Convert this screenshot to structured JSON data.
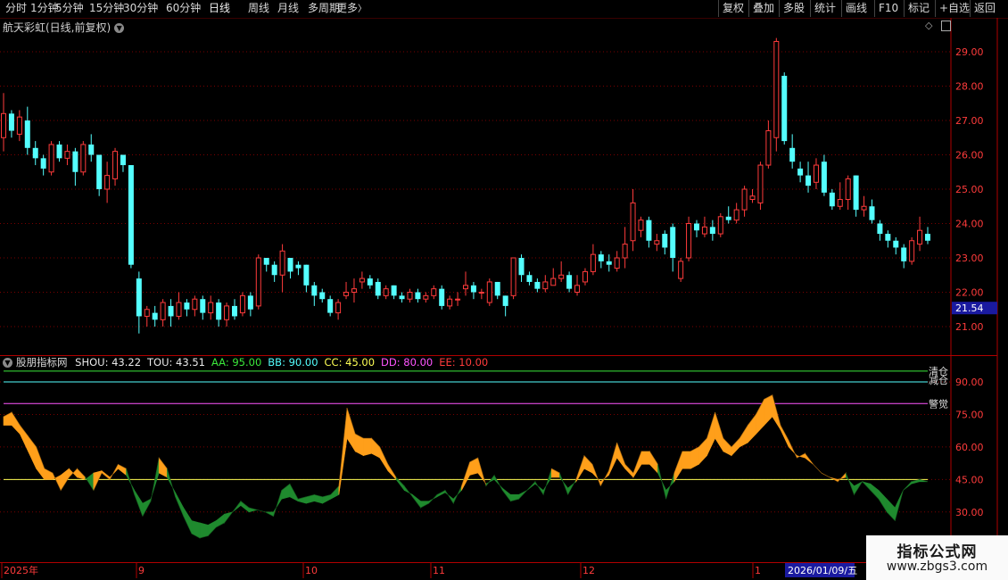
{
  "toolbar": {
    "left_items": [
      "分时",
      "1分钟",
      "5分钟",
      "15分钟",
      "30分钟",
      "60分钟",
      "日线",
      "周线",
      "月线",
      "多周期",
      "更多"
    ],
    "more_arrow": "〉",
    "active": "日线",
    "right_items": [
      "复权",
      "叠加",
      "多股",
      "统计",
      "画线",
      "F10",
      "标记",
      "+自选",
      "返回"
    ]
  },
  "main_chart": {
    "title": "航天彩虹(日线,前复权)",
    "price_axis": [
      "29.00",
      "28.00",
      "27.00",
      "26.00",
      "25.00",
      "24.00",
      "23.00",
      "22.00",
      "21.00"
    ],
    "current_price_tag": "21.54",
    "colors": {
      "up": "#ff3b3b",
      "down": "#54ffff",
      "grid": "#7a0000",
      "axis": "#ff3b3b",
      "price_tag_bg": "#1a1aa0"
    },
    "candles": [
      [
        26.5,
        27.2,
        26.1,
        27.8
      ],
      [
        27.2,
        26.7,
        26.5,
        27.3
      ],
      [
        26.6,
        27.1,
        26.4,
        27.3
      ],
      [
        27.0,
        26.2,
        26.0,
        27.4
      ],
      [
        26.2,
        25.9,
        25.7,
        26.4
      ],
      [
        25.9,
        25.6,
        25.4,
        26.0
      ],
      [
        25.5,
        26.3,
        25.4,
        26.4
      ],
      [
        26.3,
        25.9,
        25.8,
        26.4
      ],
      [
        25.9,
        26.1,
        25.7,
        26.3
      ],
      [
        26.1,
        25.5,
        25.1,
        26.2
      ],
      [
        25.5,
        26.3,
        25.4,
        26.4
      ],
      [
        26.3,
        26.0,
        25.8,
        26.6
      ],
      [
        26.0,
        25.0,
        24.8,
        26.0
      ],
      [
        25.0,
        25.4,
        24.6,
        25.8
      ],
      [
        25.3,
        26.1,
        25.1,
        26.2
      ],
      [
        26.0,
        25.7,
        25.5,
        26.0
      ],
      [
        25.7,
        22.8,
        22.7,
        25.7
      ],
      [
        22.4,
        21.3,
        20.8,
        22.6
      ],
      [
        21.3,
        21.5,
        21.0,
        21.6
      ],
      [
        21.4,
        21.2,
        21.0,
        21.6
      ],
      [
        21.2,
        21.7,
        21.0,
        21.8
      ],
      [
        21.6,
        21.3,
        21.0,
        21.8
      ],
      [
        21.3,
        21.7,
        21.2,
        22.0
      ],
      [
        21.7,
        21.5,
        21.3,
        21.8
      ],
      [
        21.5,
        21.8,
        21.3,
        21.9
      ],
      [
        21.8,
        21.4,
        21.2,
        21.9
      ],
      [
        21.4,
        21.7,
        21.2,
        21.9
      ],
      [
        21.7,
        21.2,
        21.0,
        21.8
      ],
      [
        21.2,
        21.6,
        21.0,
        21.7
      ],
      [
        21.6,
        21.3,
        21.2,
        21.8
      ],
      [
        21.4,
        21.9,
        21.3,
        22.0
      ],
      [
        21.9,
        21.5,
        21.3,
        22.0
      ],
      [
        21.6,
        23.0,
        21.5,
        23.1
      ],
      [
        23.0,
        22.8,
        22.6,
        23.0
      ],
      [
        22.8,
        22.5,
        22.3,
        22.9
      ],
      [
        22.5,
        23.2,
        22.0,
        23.4
      ],
      [
        23.0,
        22.6,
        22.4,
        23.0
      ],
      [
        22.8,
        22.7,
        22.5,
        22.9
      ],
      [
        22.8,
        22.2,
        22.0,
        22.8
      ],
      [
        22.2,
        21.9,
        21.6,
        22.3
      ],
      [
        22.0,
        21.8,
        21.7,
        22.1
      ],
      [
        21.8,
        21.4,
        21.3,
        21.9
      ],
      [
        21.4,
        21.7,
        21.2,
        21.8
      ],
      [
        21.9,
        22.0,
        21.8,
        22.3
      ],
      [
        22.0,
        22.1,
        21.7,
        22.4
      ],
      [
        22.3,
        22.4,
        22.1,
        22.6
      ],
      [
        22.4,
        22.2,
        22.1,
        22.5
      ],
      [
        22.3,
        21.9,
        21.8,
        22.4
      ],
      [
        21.9,
        22.1,
        21.8,
        22.2
      ],
      [
        22.2,
        21.9,
        21.8,
        22.2
      ],
      [
        21.9,
        21.8,
        21.7,
        22.0
      ],
      [
        21.8,
        22.0,
        21.7,
        22.1
      ],
      [
        22.0,
        21.8,
        21.7,
        22.1
      ],
      [
        21.8,
        21.9,
        21.7,
        22.0
      ],
      [
        21.9,
        22.1,
        21.8,
        22.2
      ],
      [
        22.1,
        21.6,
        21.5,
        22.2
      ],
      [
        21.6,
        21.8,
        21.5,
        21.9
      ],
      [
        21.8,
        21.8,
        21.6,
        22.0
      ],
      [
        22.1,
        22.2,
        21.9,
        22.6
      ],
      [
        22.2,
        22.0,
        21.8,
        22.3
      ],
      [
        22.0,
        22.0,
        21.8,
        22.1
      ],
      [
        21.7,
        22.3,
        21.6,
        22.4
      ],
      [
        22.3,
        21.9,
        21.8,
        22.3
      ],
      [
        21.9,
        21.6,
        21.3,
        21.9
      ],
      [
        21.9,
        23.0,
        21.8,
        23.0
      ],
      [
        23.0,
        22.5,
        22.3,
        23.1
      ],
      [
        22.5,
        22.3,
        22.2,
        22.6
      ],
      [
        22.3,
        22.1,
        22.0,
        22.4
      ],
      [
        22.1,
        22.3,
        22.0,
        22.5
      ],
      [
        22.2,
        22.4,
        22.2,
        22.7
      ],
      [
        22.4,
        22.5,
        22.3,
        22.9
      ],
      [
        22.5,
        22.1,
        22.0,
        22.6
      ],
      [
        22.0,
        22.2,
        21.9,
        22.5
      ],
      [
        22.3,
        22.6,
        22.2,
        22.7
      ],
      [
        22.6,
        23.1,
        22.5,
        23.4
      ],
      [
        23.1,
        22.9,
        22.7,
        23.2
      ],
      [
        22.9,
        22.8,
        22.6,
        23.1
      ],
      [
        22.7,
        23.0,
        22.6,
        23.2
      ],
      [
        23.0,
        23.4,
        22.7,
        23.9
      ],
      [
        23.5,
        24.6,
        23.2,
        25.0
      ],
      [
        23.8,
        24.1,
        23.6,
        24.2
      ],
      [
        24.1,
        23.5,
        23.3,
        24.2
      ],
      [
        23.4,
        23.5,
        23.2,
        23.7
      ],
      [
        23.7,
        23.3,
        23.1,
        23.8
      ],
      [
        23.9,
        23.0,
        22.6,
        24.0
      ],
      [
        22.4,
        22.9,
        22.3,
        23.0
      ],
      [
        23.0,
        24.0,
        22.9,
        24.2
      ],
      [
        24.0,
        23.8,
        23.6,
        24.1
      ],
      [
        23.7,
        23.9,
        23.6,
        24.2
      ],
      [
        23.9,
        23.7,
        23.5,
        24.1
      ],
      [
        23.7,
        24.2,
        23.6,
        24.3
      ],
      [
        24.2,
        24.1,
        24.0,
        24.5
      ],
      [
        24.1,
        24.4,
        24.0,
        24.6
      ],
      [
        24.4,
        25.0,
        24.2,
        25.1
      ],
      [
        24.7,
        24.8,
        24.6,
        25.0
      ],
      [
        24.6,
        25.7,
        24.4,
        25.8
      ],
      [
        25.7,
        26.7,
        25.6,
        27.0
      ],
      [
        26.5,
        29.3,
        26.1,
        29.4
      ],
      [
        28.3,
        26.4,
        26.3,
        28.4
      ],
      [
        26.2,
        25.8,
        25.6,
        26.6
      ],
      [
        25.6,
        25.4,
        25.2,
        25.8
      ],
      [
        25.4,
        25.1,
        24.9,
        25.8
      ],
      [
        25.2,
        25.7,
        25.0,
        25.9
      ],
      [
        25.8,
        24.9,
        24.8,
        26.0
      ],
      [
        24.9,
        24.5,
        24.4,
        25.0
      ],
      [
        24.5,
        24.7,
        24.4,
        25.2
      ],
      [
        24.7,
        25.3,
        24.4,
        25.4
      ],
      [
        25.4,
        24.4,
        24.2,
        25.4
      ],
      [
        24.4,
        24.5,
        24.2,
        24.8
      ],
      [
        24.5,
        24.1,
        24.0,
        24.7
      ],
      [
        24.0,
        23.7,
        23.5,
        24.1
      ],
      [
        23.7,
        23.5,
        23.3,
        23.8
      ],
      [
        23.5,
        23.3,
        23.1,
        23.6
      ],
      [
        23.3,
        22.9,
        22.7,
        23.4
      ],
      [
        22.9,
        23.5,
        22.8,
        23.6
      ],
      [
        23.4,
        23.8,
        23.2,
        24.2
      ],
      [
        23.7,
        23.5,
        23.4,
        23.9
      ]
    ]
  },
  "indicator": {
    "name": "股朋指标网",
    "values": [
      {
        "label": "SHOU: 43.22",
        "color": "#e8e8e8"
      },
      {
        "label": "TOU: 43.51",
        "color": "#e8e8e8"
      },
      {
        "label": "AA: 95.00",
        "color": "#3be83b"
      },
      {
        "label": "BB: 90.00",
        "color": "#54ffff"
      },
      {
        "label": "CC: 45.00",
        "color": "#ffff55"
      },
      {
        "label": "DD: 80.00",
        "color": "#ff55ff"
      },
      {
        "label": "EE: 10.00",
        "color": "#ff3b3b"
      }
    ],
    "axis": [
      "90.00",
      "75.00",
      "60.00",
      "45.00",
      "30.00"
    ],
    "labels": {
      "aa_label": "清仓",
      "bb_label": "减仓",
      "dd_label": "警觉"
    },
    "shou": [
      74,
      76,
      70,
      65,
      60,
      50,
      48,
      40,
      46,
      50,
      46,
      40,
      48,
      45,
      52,
      50,
      38,
      28,
      35,
      55,
      50,
      37,
      28,
      20,
      18,
      19,
      23,
      25,
      30,
      35,
      32,
      31,
      30,
      28,
      40,
      43,
      36,
      37,
      38,
      37,
      38,
      42,
      78,
      66,
      64,
      64,
      60,
      52,
      46,
      42,
      37,
      32,
      34,
      38,
      40,
      34,
      42,
      53,
      55,
      42,
      47,
      40,
      35,
      36,
      40,
      44,
      38,
      50,
      48,
      38,
      45,
      56,
      52,
      42,
      49,
      62,
      52,
      48,
      58,
      58,
      52,
      36,
      48,
      58,
      58,
      60,
      64,
      76,
      64,
      60,
      64,
      70,
      75,
      82,
      84,
      70,
      63,
      55,
      57,
      52,
      48,
      46,
      44,
      48,
      38,
      44,
      40,
      36,
      30,
      26,
      40,
      44,
      45,
      44
    ],
    "tou": [
      70,
      70,
      66,
      58,
      50,
      45,
      45,
      47,
      50,
      46,
      45,
      48,
      49,
      46,
      50,
      47,
      40,
      34,
      36,
      48,
      46,
      39,
      32,
      26,
      25,
      24,
      26,
      29,
      30,
      33,
      30,
      31,
      30,
      30,
      36,
      37,
      35,
      34,
      35,
      34,
      36,
      38,
      64,
      58,
      56,
      57,
      55,
      49,
      45,
      40,
      38,
      35,
      35,
      37,
      39,
      36,
      40,
      47,
      48,
      43,
      45,
      41,
      38,
      38,
      40,
      43,
      40,
      46,
      46,
      41,
      44,
      50,
      48,
      44,
      47,
      55,
      50,
      46,
      52,
      52,
      48,
      40,
      44,
      50,
      50,
      52,
      56,
      64,
      58,
      56,
      60,
      62,
      66,
      70,
      74,
      68,
      60,
      56,
      55,
      52,
      48,
      46,
      45,
      46,
      42,
      44,
      43,
      40,
      36,
      32,
      40,
      43,
      44,
      44
    ]
  },
  "time_axis": {
    "labels": [
      "2025年",
      "9",
      "10",
      "11",
      "12",
      "1"
    ],
    "date_tag": "2026/01/09/五"
  },
  "watermark": {
    "line1": "指标公式网",
    "line2": "www.zbgs3.com"
  }
}
